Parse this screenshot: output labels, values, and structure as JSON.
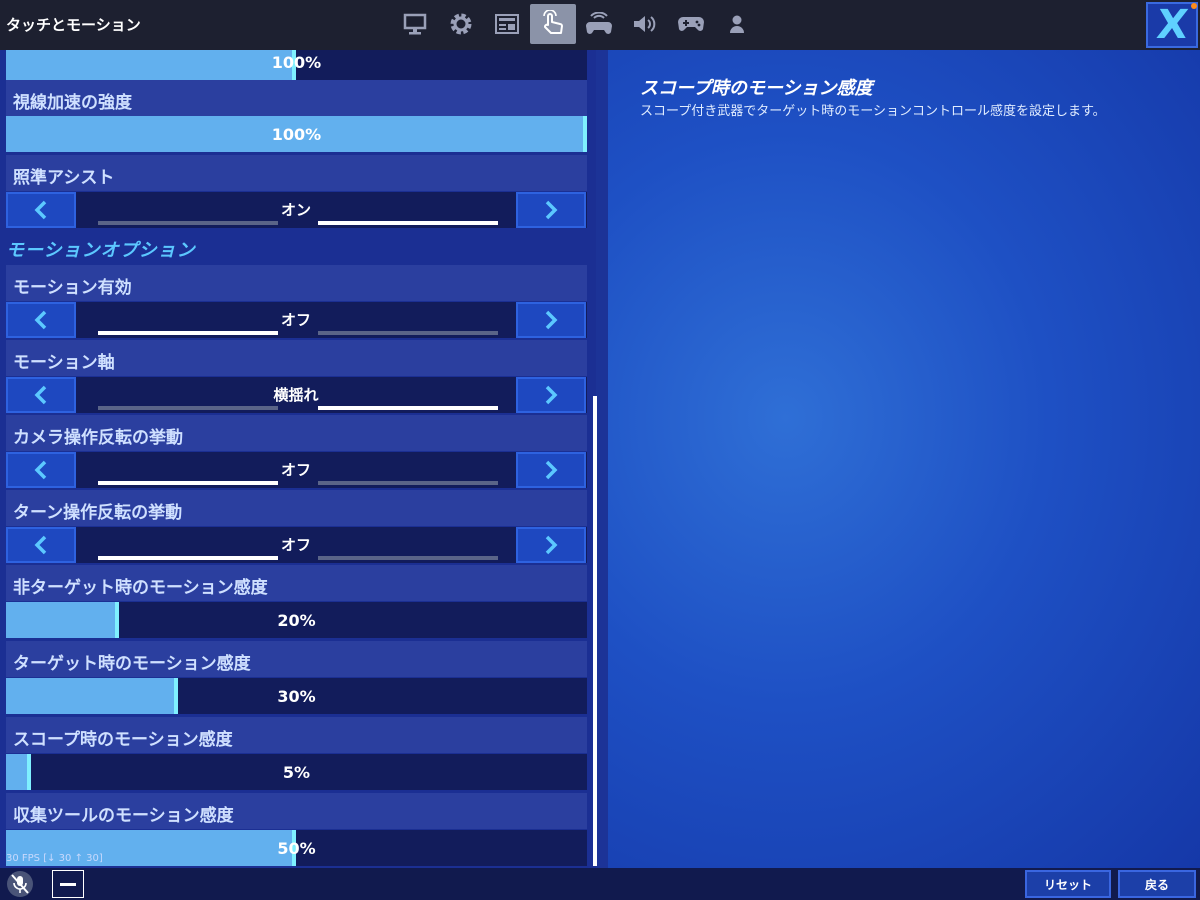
{
  "topbar": {
    "title": "タッチとモーション",
    "tabs": [
      {
        "icon": "monitor-icon"
      },
      {
        "icon": "gear-icon"
      },
      {
        "icon": "hud-icon"
      },
      {
        "icon": "touch-icon",
        "active": true
      },
      {
        "icon": "controller-wireless-icon"
      },
      {
        "icon": "speaker-icon"
      },
      {
        "icon": "gamepad-icon"
      },
      {
        "icon": "user-icon"
      }
    ],
    "close_label": "X"
  },
  "settings": {
    "partial_top": {
      "value": "100%",
      "level": 0.5
    },
    "gaze_accel": {
      "label": "視線加速の強度",
      "value": "100%",
      "level": 1.0
    },
    "aim_assist": {
      "label": "照準アシスト",
      "value": "オン"
    },
    "motion_section": "モーションオプション",
    "motion_enabled": {
      "label": "モーション有効",
      "value": "オフ"
    },
    "motion_axis": {
      "label": "モーション軸",
      "value": "横揺れ"
    },
    "camera_invert": {
      "label": "カメラ操作反転の挙動",
      "value": "オフ"
    },
    "turn_invert": {
      "label": "ターン操作反転の挙動",
      "value": "オフ"
    },
    "non_target_sens": {
      "label": "非ターゲット時のモーション感度",
      "value": "20%",
      "level": 0.2
    },
    "target_sens": {
      "label": "ターゲット時のモーション感度",
      "value": "30%",
      "level": 0.3
    },
    "scope_sens": {
      "label": "スコープ時のモーション感度",
      "value": "5%",
      "level": 0.05
    },
    "harvest_sens": {
      "label": "収集ツールのモーション感度",
      "value": "50%",
      "level": 0.5
    }
  },
  "description": {
    "title": "スコープ時のモーション感度",
    "text": "スコープ付き武器でターゲット時のモーションコントロール感度を設定します。"
  },
  "footer": {
    "fps": "30 FPS [↓ 30 ↑ 30]",
    "reset_label": "リセット",
    "back_label": "戻る"
  },
  "colors": {
    "accent": "#5cc8ff",
    "slider_fill": "#62b0ee",
    "panel_bg": "#1b2f93"
  }
}
